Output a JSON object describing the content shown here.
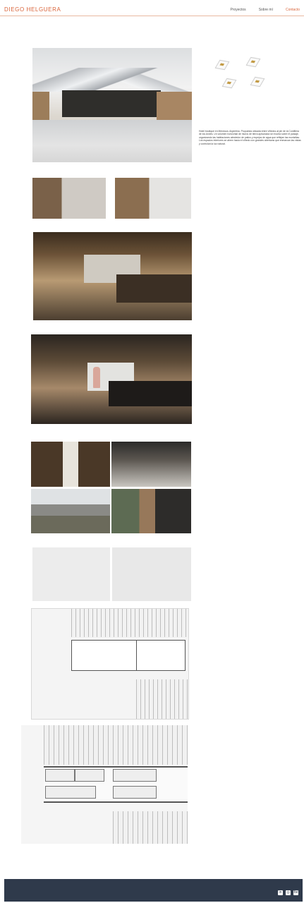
{
  "header": {
    "logo": "DIEGO HELGUERA",
    "nav": [
      "Proyectos",
      "Sobre mí",
      "Contacto"
    ]
  },
  "project": {
    "description": "Hotel boutique en Mendoza, Argentina. Propuesta ubicada entre viñedos al pie de la Cordillera de los Andes. Un volumen horizontal de muros de tierra apisonada se recorta sobre el paisaje, organizando las habitaciones alrededor de patios y espejos de agua que reflejan las montañas. Los espacios interiores se abren hacia el viñedo con grandes aberturas que enmarcan las vistas y controlan la luz natural."
  },
  "footer": {
    "icons": [
      "linkedin-icon",
      "instagram-icon",
      "behance-icon"
    ]
  }
}
